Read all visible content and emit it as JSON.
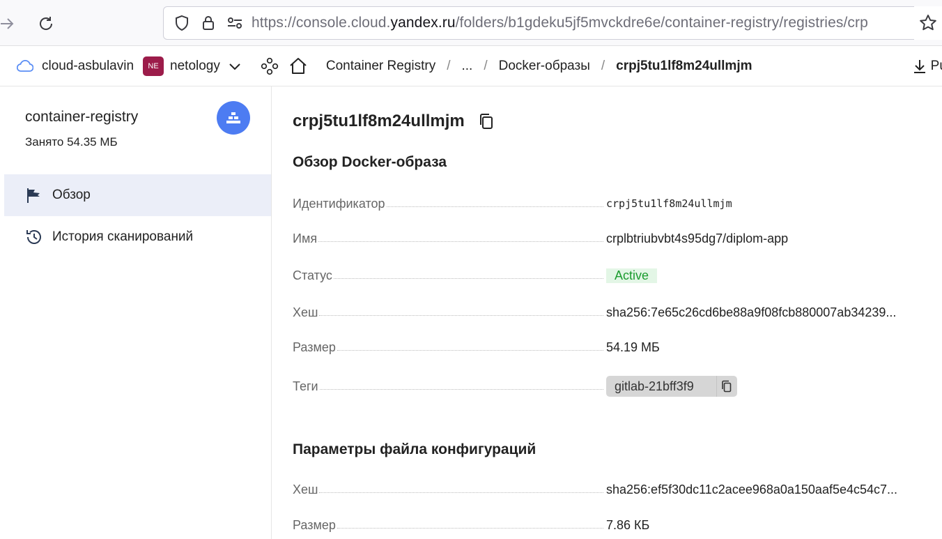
{
  "browser": {
    "url_prefix": "https://console.cloud.",
    "url_host": "yandex.ru",
    "url_rest": "/folders/b1gdeku5jf5mvckdre6e/container-registry/registries/crp"
  },
  "header": {
    "cloud": "cloud-asbulavin",
    "folder_badge": "NE",
    "folder": "netology",
    "breadcrumbs": [
      "Container Registry",
      "...",
      "Docker-образы"
    ],
    "breadcrumb_current": "crpj5tu1lf8m24ullmjm",
    "pull_label": "Pull-к"
  },
  "sidebar": {
    "title": "container-registry",
    "usage": "Занято 54.35 МБ",
    "items": [
      {
        "label": "Обзор",
        "icon": "flag-icon",
        "active": true
      },
      {
        "label": "История сканирований",
        "icon": "history-icon",
        "active": false
      }
    ]
  },
  "main": {
    "title": "crpj5tu1lf8m24ullmjm",
    "overview": {
      "heading": "Обзор Docker-образа",
      "id_label": "Идентификатор",
      "id_value": "crpj5tu1lf8m24ullmjm",
      "name_label": "Имя",
      "name_value": "crplbtriubvbt4s95dg7/diplom-app",
      "status_label": "Статус",
      "status_value": "Active",
      "hash_label": "Хеш",
      "hash_value": "sha256:7e65c26cd6be88a9f08fcb880007ab34239...",
      "size_label": "Размер",
      "size_value": "54.19 МБ",
      "tags_label": "Теги",
      "tag_value": "gitlab-21bff3f9"
    },
    "config": {
      "heading": "Параметры файла конфигураций",
      "hash_label": "Хеш",
      "hash_value": "sha256:ef5f30dc11c2acee968a0a150aaf5e4c54c7...",
      "size_label": "Размер",
      "size_value": "7.86 КБ"
    }
  },
  "colors": {
    "accent": "#4d7cf2",
    "status_green": "#1b9c2f",
    "active_item_bg": "#ebeef8",
    "folder_badge": "#9c1c4a"
  }
}
